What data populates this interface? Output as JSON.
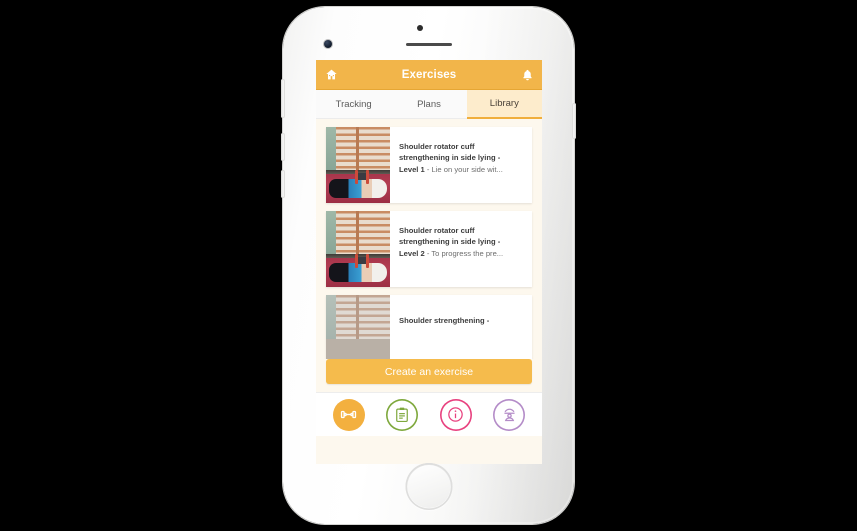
{
  "device": {
    "name": "iphone-white",
    "bezel_color": "#ffffff"
  },
  "app": {
    "header": {
      "title": "Exercises",
      "left_icon": "home-icon",
      "right_icon": "bell-icon",
      "bg_color": "#F2B54A",
      "text_color": "#FFFFFF"
    },
    "tabs": [
      {
        "label": "Tracking",
        "active": false
      },
      {
        "label": "Plans",
        "active": false
      },
      {
        "label": "Library",
        "active": true
      }
    ],
    "tab_active_bg": "#FDECCC",
    "tab_active_underline": "#F0AE3B",
    "list_bg": "#FDF8EE",
    "exercises": [
      {
        "title": "Shoulder rotator cuff strengthening in side lying - Level 1",
        "title_line_1": "Shoulder rotator cuff",
        "title_line_2": "strengthening in side lying -",
        "level": "Level 1",
        "description": " - Lie on your side wit...",
        "thumbnail": "person-lying-on-red-mat-gym-thumbnail"
      },
      {
        "title": "Shoulder rotator cuff strengthening in side lying - Level 2",
        "title_line_1": "Shoulder rotator cuff",
        "title_line_2": "strengthening in side lying -",
        "level": "Level 2",
        "description": " - To progress the pre...",
        "thumbnail": "person-lying-on-red-mat-with-dumbbell-thumbnail"
      },
      {
        "title": "Shoulder strengthening -",
        "title_line_1": "Shoulder strengthening -",
        "title_line_2": "",
        "level": "",
        "description": "",
        "thumbnail": "gym-wall-bars-thumbnail"
      }
    ],
    "cta": {
      "label": "Create an exercise",
      "bg_color": "#F5BB4C"
    },
    "bottom_nav": [
      {
        "icon": "dumbbell-icon",
        "label": "Exercises",
        "active": true,
        "color": "#F3B03F"
      },
      {
        "icon": "clipboard-icon",
        "label": "Plans",
        "active": false,
        "color": "#7EA83C"
      },
      {
        "icon": "info-icon",
        "label": "Info",
        "active": false,
        "color": "#E8417F"
      },
      {
        "icon": "treatment-table-icon",
        "label": "Treatment",
        "active": false,
        "color": "#B48CC8"
      }
    ]
  }
}
